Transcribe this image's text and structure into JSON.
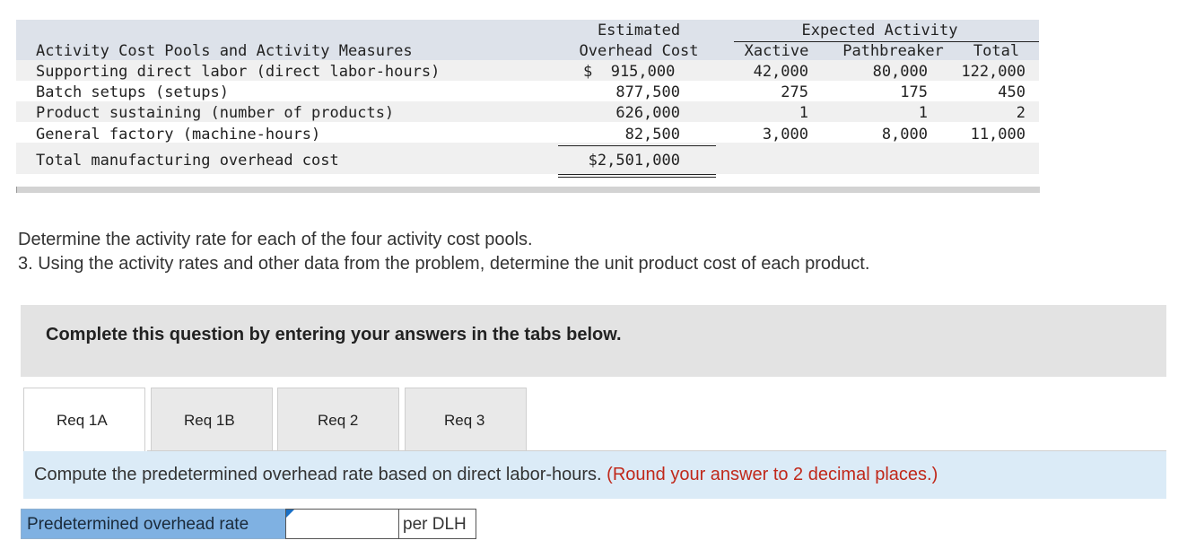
{
  "table": {
    "header": {
      "estimated_line1": "Estimated",
      "estimated_line2": "Overhead Cost",
      "expected_group": "Expected Activity",
      "col_xactive": "Xactive",
      "col_pathbreaker": "Pathbreaker",
      "col_total": "Total",
      "row_title": "Activity Cost Pools and Activity Measures"
    },
    "rows": [
      {
        "label": "Supporting direct labor (direct labor-hours)",
        "cost": "$  915,000",
        "xactive": "42,000",
        "pathbreaker": "80,000",
        "total": "122,000"
      },
      {
        "label": "Batch setups (setups)",
        "cost": "877,500",
        "xactive": "275",
        "pathbreaker": "175",
        "total": "450"
      },
      {
        "label": "Product sustaining (number of products)",
        "cost": "626,000",
        "xactive": "1",
        "pathbreaker": "1",
        "total": "2"
      },
      {
        "label": "General factory (machine-hours)",
        "cost": "82,500",
        "xactive": "3,000",
        "pathbreaker": "8,000",
        "total": "11,000"
      }
    ],
    "total_label": "Total manufacturing overhead cost",
    "total_cost": "$2,501,000"
  },
  "instructions": {
    "line1": "Determine the activity rate for each of the four activity cost pools.",
    "line2": "3. Using the activity rates and other data from the problem, determine the unit product cost of each product."
  },
  "question": {
    "text": "Complete this question by entering your answers in the tabs below."
  },
  "tabs": [
    {
      "label": "Req 1A",
      "active": true
    },
    {
      "label": "Req 1B",
      "active": false
    },
    {
      "label": "Req 2",
      "active": false
    },
    {
      "label": "Req 3",
      "active": false
    }
  ],
  "compute": {
    "text": "Compute the predetermined overhead rate based on direct labor-hours.",
    "hint": "(Round your answer to 2 decimal places.)"
  },
  "answer": {
    "label": "Predetermined overhead rate",
    "value": "",
    "unit": "per DLH"
  },
  "colors": {
    "header_band": "#dde2ea",
    "question_box": "#e3e3e3",
    "compute_band": "#dbebf7",
    "hint_red": "#c0281a",
    "answer_label_bg": "#7fb1e2"
  }
}
